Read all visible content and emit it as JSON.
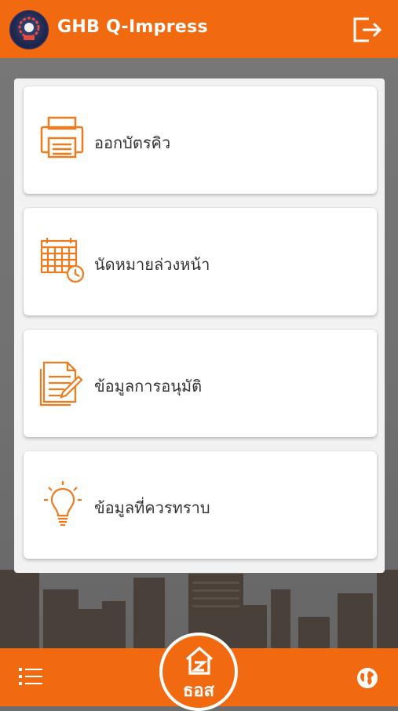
{
  "header": {
    "title": "GHB Q-Impress",
    "logo_icon": "ghb-logo-icon",
    "logout_icon": "logout-icon"
  },
  "menu": [
    {
      "label": "ออกบัตรคิว",
      "icon": "printer-icon"
    },
    {
      "label": "นัดหมายล่วงหน้า",
      "icon": "calendar-clock-icon"
    },
    {
      "label": "ข้อมูลการอนุมัติ",
      "icon": "document-edit-icon"
    },
    {
      "label": "ข้อมูลที่ควรทราบ",
      "icon": "lightbulb-icon"
    }
  ],
  "footer": {
    "menu_icon": "menu-list-icon",
    "center_label": "ธอส",
    "globe_icon": "globe-icon"
  },
  "colors": {
    "accent": "#f26a0f",
    "card": "#ffffff",
    "text": "#333333"
  }
}
